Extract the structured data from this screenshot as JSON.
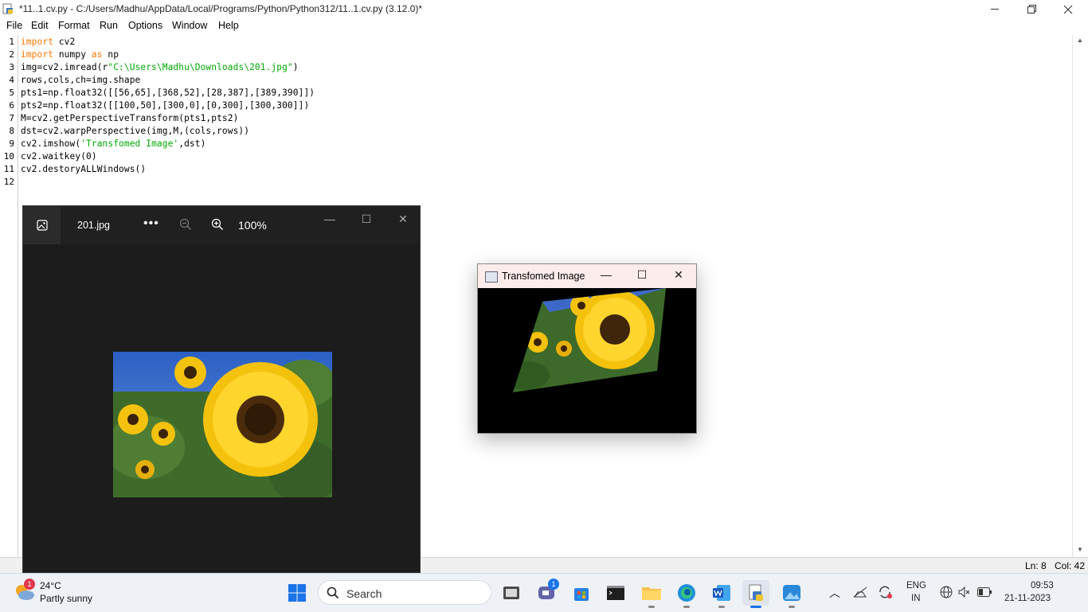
{
  "window": {
    "title": "*11..1.cv.py - C:/Users/Madhu/AppData/Local/Programs/Python/Python312/11..1.cv.py (3.12.0)*"
  },
  "menu": [
    "File",
    "Edit",
    "Format",
    "Run",
    "Options",
    "Window",
    "Help"
  ],
  "editor": {
    "line_numbers": [
      "1",
      "2",
      "3",
      "4",
      "5",
      "6",
      "7",
      "8",
      "9",
      "10",
      "11",
      "12"
    ],
    "lines": [
      [
        {
          "t": "import",
          "c": "kw"
        },
        {
          "t": " cv2",
          "c": ""
        }
      ],
      [
        {
          "t": "import",
          "c": "kw"
        },
        {
          "t": " numpy ",
          "c": ""
        },
        {
          "t": "as",
          "c": "kw"
        },
        {
          "t": " np",
          "c": ""
        }
      ],
      [
        {
          "t": "img=cv2.imread(r",
          "c": ""
        },
        {
          "t": "\"C:\\Users\\Madhu\\Downloads\\201.jpg\"",
          "c": "str"
        },
        {
          "t": ")",
          "c": ""
        }
      ],
      [
        {
          "t": "rows,cols,ch=img.shape",
          "c": ""
        }
      ],
      [
        {
          "t": "pts1=np.float32([[56,65],[368,52],[28,387],[389,390]])",
          "c": ""
        }
      ],
      [
        {
          "t": "pts2=np.float32([[100,50],[300,0],[0,300],[300,300]])",
          "c": ""
        }
      ],
      [
        {
          "t": "M=cv2.getPerspectiveTransform(pts1,pts2)",
          "c": ""
        }
      ],
      [
        {
          "t": "dst=cv2.warpPerspective(img,M,(cols,rows))",
          "c": ""
        }
      ],
      [
        {
          "t": "cv2.imshow(",
          "c": ""
        },
        {
          "t": "'Transfomed Image'",
          "c": "str"
        },
        {
          "t": ",dst)",
          "c": ""
        }
      ],
      [
        {
          "t": "cv2.waitkey(0)",
          "c": ""
        }
      ],
      [
        {
          "t": "cv2.destoryALLWindows()",
          "c": ""
        }
      ],
      []
    ]
  },
  "status": {
    "line": "Ln: 8",
    "col": "Col: 42"
  },
  "photos": {
    "filename": "201.jpg",
    "more": "•••",
    "zoom": "100%"
  },
  "cv_window": {
    "title": "Transfomed Image"
  },
  "taskbar": {
    "weather_temp": "24°C",
    "weather_desc": "Partly sunny",
    "weather_badge": "1",
    "search_placeholder": "Search",
    "teams_badge": "1",
    "lang_top": "ENG",
    "lang_bottom": "IN",
    "time": "09:53",
    "date": "21-11-2023"
  },
  "colors": {
    "keyword": "#ff7700",
    "string": "#00aa00",
    "photos_bg": "#1c1c1c",
    "taskbar_bg": "#eef1f6"
  }
}
